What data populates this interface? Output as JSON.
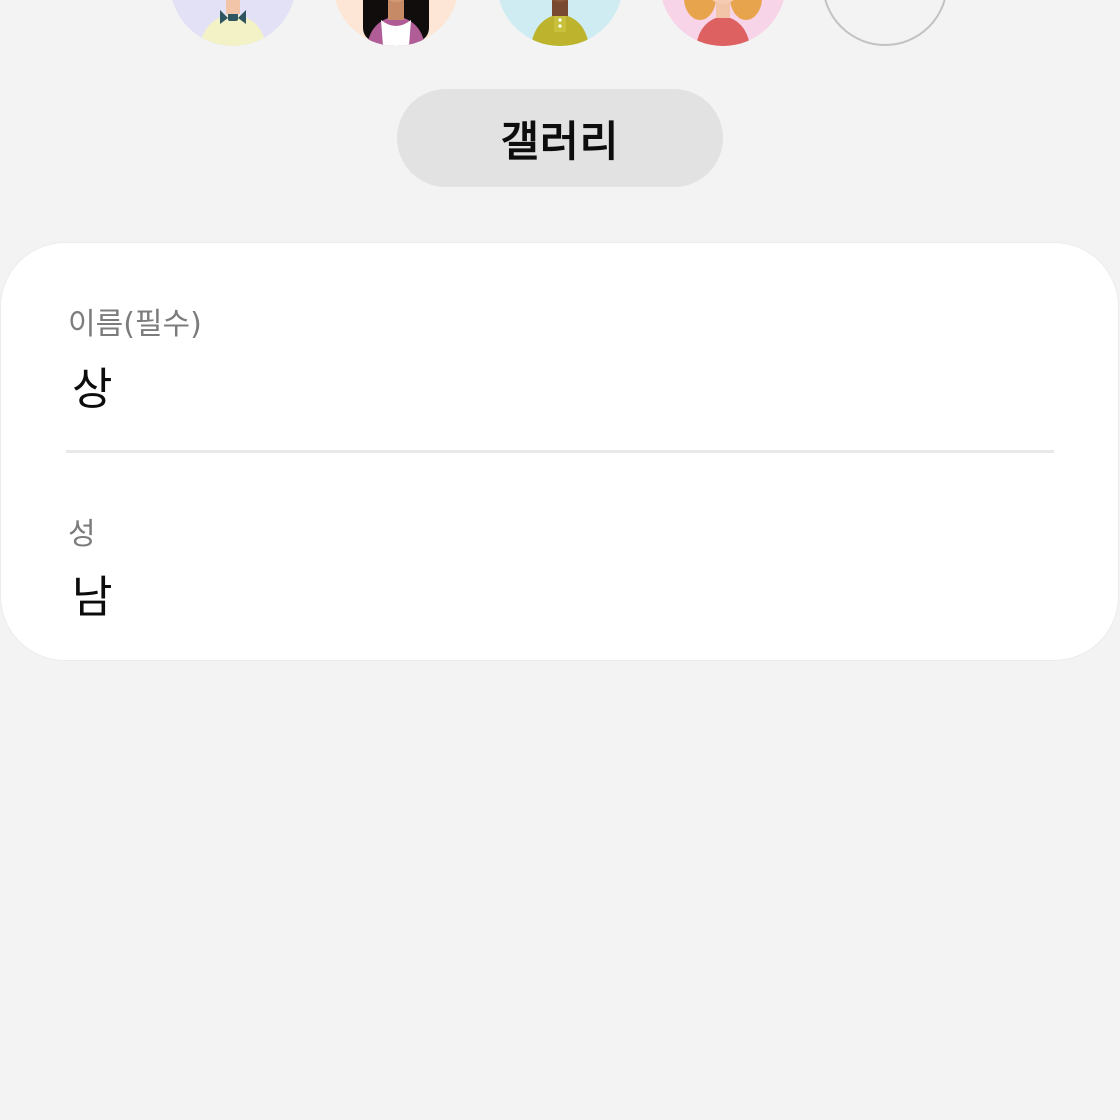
{
  "avatars": {
    "items": [
      {
        "name": "avatar-boy-purple",
        "bg": "#e3e1f5"
      },
      {
        "name": "avatar-girl-peach",
        "bg": "#fde6d6"
      },
      {
        "name": "avatar-boy-blue",
        "bg": "#cfecf2"
      },
      {
        "name": "avatar-girl-pink",
        "bg": "#f7d4e8"
      },
      {
        "name": "avatar-empty-slot",
        "bg": "transparent"
      }
    ]
  },
  "gallery_button": {
    "label": "갤러리"
  },
  "name_card": {
    "first_name": {
      "label": "이름(필수)",
      "value": "상"
    },
    "last_name": {
      "label": "성",
      "value": "남"
    }
  },
  "colors": {
    "background": "#f3f3f3",
    "card": "#ffffff",
    "button": "#e2e2e2",
    "label": "#7c7c7c",
    "value": "#0c0c0c"
  }
}
